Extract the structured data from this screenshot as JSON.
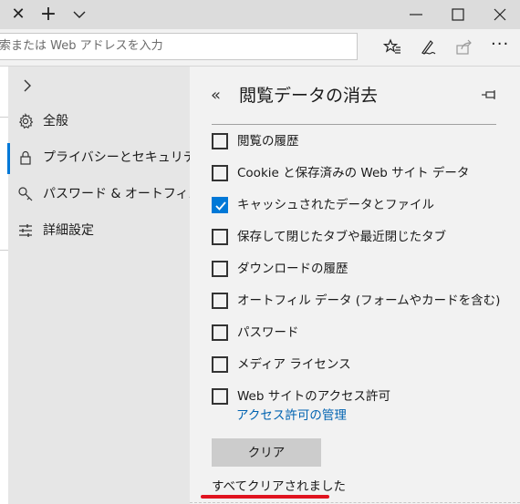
{
  "address_bar": {
    "placeholder": "索または Web アドレスを入力"
  },
  "sidebar": {
    "items": [
      {
        "label": "全般",
        "icon": "gear-icon"
      },
      {
        "label": "プライバシーとセキュリティ",
        "icon": "lock-icon",
        "active": true
      },
      {
        "label": "パスワード & オートフィル",
        "icon": "key-icon"
      },
      {
        "label": "詳細設定",
        "icon": "sliders-icon"
      }
    ]
  },
  "panel": {
    "back_glyph": "«",
    "title": "閲覧データの消去",
    "options": [
      {
        "label": "閲覧の履歴",
        "checked": false
      },
      {
        "label": "Cookie と保存済みの Web サイト データ",
        "checked": false
      },
      {
        "label": "キャッシュされたデータとファイル",
        "checked": true
      },
      {
        "label": "保存して閉じたタブや最近閉じたタブ",
        "checked": false
      },
      {
        "label": "ダウンロードの履歴",
        "checked": false
      },
      {
        "label": "オートフィル データ (フォームやカードを含む)",
        "checked": false
      },
      {
        "label": "パスワード",
        "checked": false
      },
      {
        "label": "メディア ライセンス",
        "checked": false
      },
      {
        "label": "Web サイトのアクセス許可",
        "checked": false
      }
    ],
    "manage_link": "アクセス許可の管理",
    "clear_button": "クリア",
    "status": "すべてクリアされました"
  },
  "colors": {
    "accent": "#0078d7",
    "link": "#0063b1",
    "annotation": "#e0131f"
  }
}
